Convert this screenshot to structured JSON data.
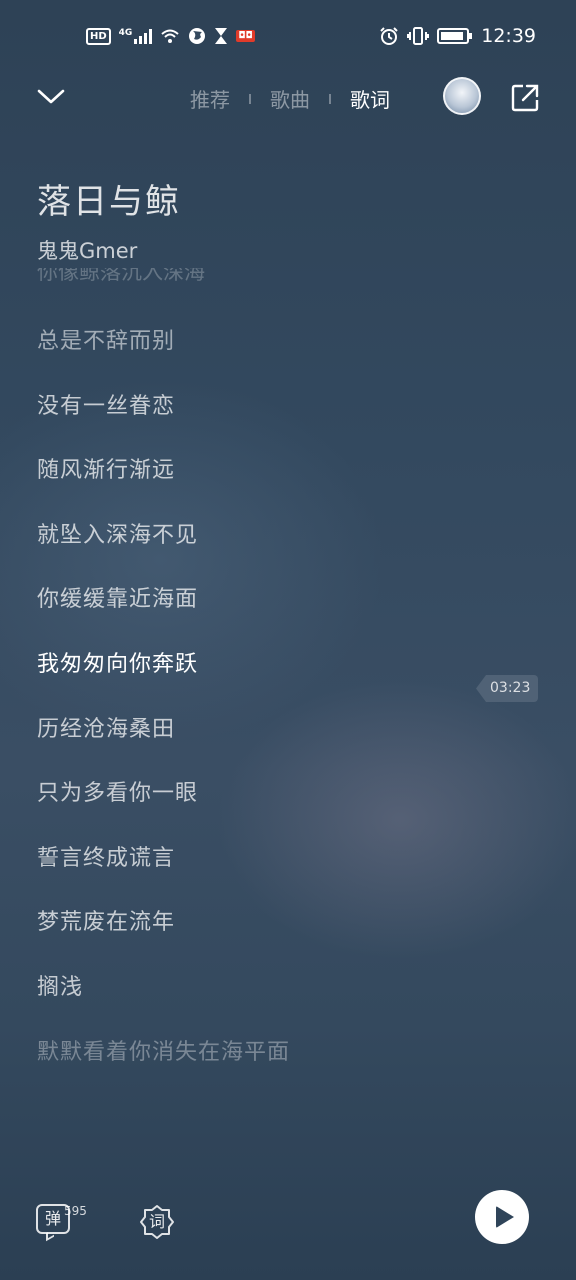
{
  "status_bar": {
    "left_icons": [
      "hd-icon",
      "4g-signal-icon",
      "wifi-icon",
      "vpn-globe-icon",
      "hourglass-icon",
      "app-notification-icon"
    ],
    "hd_label": "HD",
    "network_label": "4G",
    "right_icons": [
      "alarm-icon",
      "vibrate-icon",
      "battery-icon"
    ],
    "battery_level": 0.9,
    "time": "12:39"
  },
  "nav": {
    "tabs": [
      "推荐",
      "歌曲",
      "歌词"
    ],
    "active_tab": "歌词"
  },
  "song": {
    "title": "落日与鲸",
    "artist": "鬼鬼Gmer",
    "faded_prev_line": "你像鲸落沉入深海"
  },
  "lyrics": [
    "总是不辞而别",
    "没有一丝眷恋",
    "随风渐行渐远",
    "就坠入深海不见",
    "你缓缓靠近海面",
    "我匆匆向你奔跃",
    "历经沧海桑田",
    "只为多看你一眼",
    "誓言终成谎言",
    "梦荒废在流年",
    "搁浅",
    "默默看着你消失在海平面"
  ],
  "current_line_index": 5,
  "seek_time": "03:23",
  "bottom": {
    "danmu_label": "弹",
    "danmu_count": "595",
    "lyrics_button_label": "词"
  },
  "colors": {
    "background_top": "#2e4256",
    "background_bottom": "#2b3f53",
    "play_button": "#ffffff"
  }
}
